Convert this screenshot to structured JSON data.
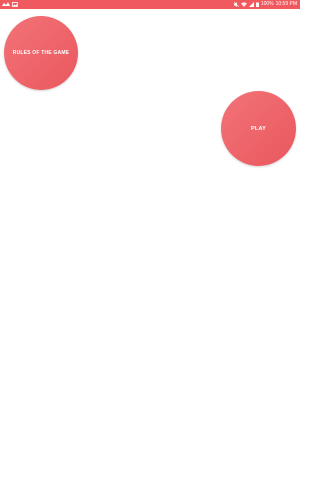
{
  "status_bar": {
    "battery": "100%",
    "time": "10:59 PM",
    "left_icons": [
      "notification-icon",
      "gallery-icon"
    ],
    "right_icons": [
      "mute-icon",
      "wifi-icon",
      "signal-icon",
      "battery-icon"
    ],
    "color": "#f05a5e"
  },
  "buttons": {
    "rules_label": "RULES OF THE GAME",
    "play_label": "PLAY",
    "color": "#f06a6e"
  }
}
